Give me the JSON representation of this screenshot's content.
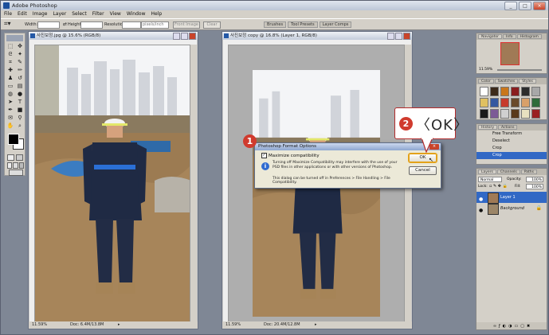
{
  "window": {
    "title": "Adobe Photoshop",
    "minimize": "_",
    "maximize": "□",
    "close": "×"
  },
  "menu": [
    "File",
    "Edit",
    "Image",
    "Layer",
    "Select",
    "Filter",
    "View",
    "Window",
    "Help"
  ],
  "options": {
    "width_label": "Width:",
    "height_label": "Height:",
    "resolution_label": "Resolution:",
    "resolution_unit": "pixels/inch",
    "front_image": "Front Image",
    "clear": "Clear"
  },
  "palette_well": [
    "Brushes",
    "Tool Presets",
    "Layer Comps"
  ],
  "doc1": {
    "title": "사진보정.jpg @ 15.6% (RGB/8)",
    "zoom": "11.59%",
    "doc": "Doc: 6.4M/13.8M"
  },
  "doc2": {
    "title": "사진보정 copy @ 16.8% (Layer 1, RGB/8)",
    "zoom": "11.59%",
    "doc": "Doc: 20.4M/12.8M"
  },
  "dialog": {
    "title": "Photoshop Format Options",
    "checkbox": "Maximize compatibility",
    "message": "Turning off Maximize Compatibility may interfere with the use of your PSD files in other applications or with other versions of Photoshop.",
    "note": "This dialog can be turned off in Preferences > File Handling > File Compatibility.",
    "ok": "OK",
    "cancel": "Cancel",
    "close": "×"
  },
  "callouts": {
    "step1": "1",
    "step2": "2",
    "ok_text": "〈OK〉"
  },
  "navigator": {
    "tabs": [
      "Navigator",
      "Info",
      "Histogram"
    ],
    "zoom": "11.59%"
  },
  "styles": {
    "tabs": [
      "Color",
      "Swatches",
      "Styles"
    ]
  },
  "history": {
    "tabs": [
      "History",
      "Actions"
    ],
    "items": [
      "Free Transform",
      "Deselect",
      "Crop",
      "Crop"
    ]
  },
  "layers": {
    "tabs": [
      "Layers",
      "Channels",
      "Paths"
    ],
    "blend": "Normal",
    "opacity_label": "Opacity:",
    "opacity": "100%",
    "lock_label": "Lock:",
    "fill_label": "Fill:",
    "fill": "100%",
    "items": [
      "Layer 1",
      "Background"
    ]
  },
  "colors": {
    "accent": "#3168c5",
    "callout": "#d03b2e",
    "ok_highlight": "#e3a21a"
  }
}
